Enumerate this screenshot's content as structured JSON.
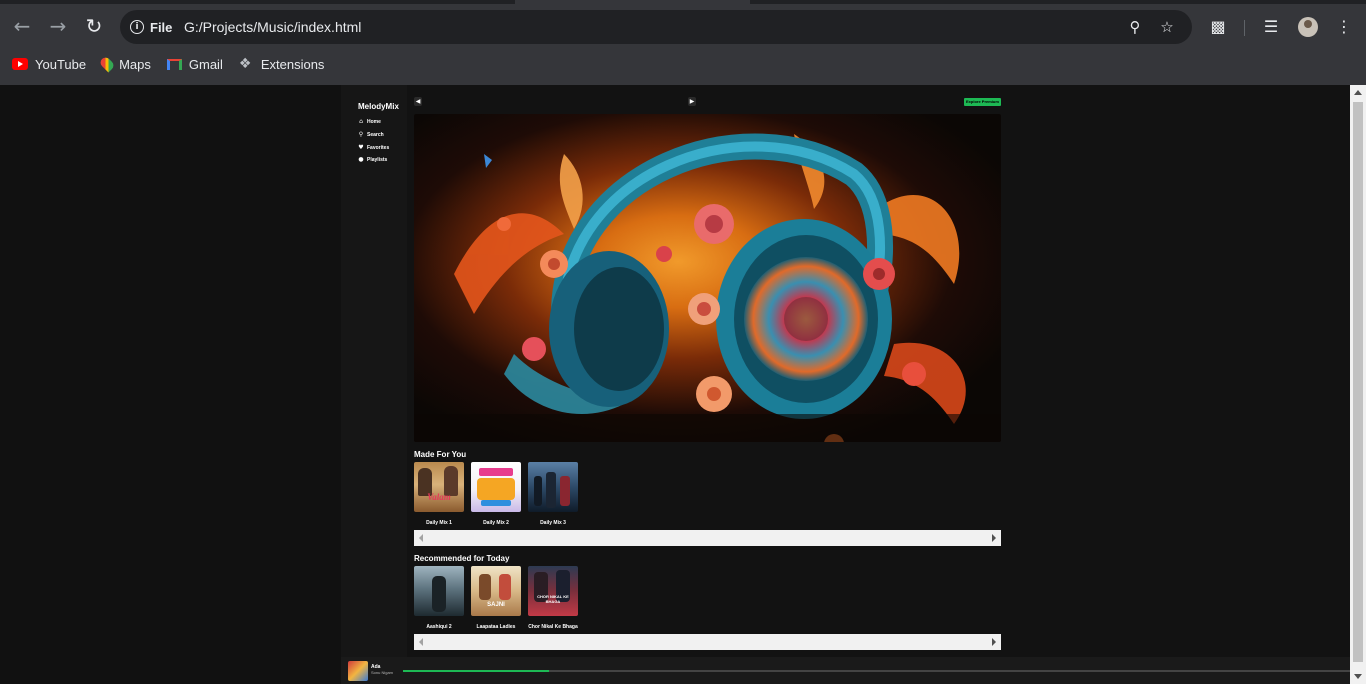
{
  "browser": {
    "url_chip": "File",
    "url": "G:/Projects/Music/index.html",
    "bookmarks": [
      {
        "label": "YouTube",
        "icon": "youtube-icon"
      },
      {
        "label": "Maps",
        "icon": "maps-icon"
      },
      {
        "label": "Gmail",
        "icon": "gmail-icon"
      },
      {
        "label": "Extensions",
        "icon": "puzzle-icon"
      }
    ]
  },
  "app": {
    "brand": "MelodyMix",
    "nav": [
      {
        "label": "Home",
        "icon": "home-icon"
      },
      {
        "label": "Search",
        "icon": "search-icon"
      },
      {
        "label": "Favorites",
        "icon": "heart-icon"
      },
      {
        "label": "Playlists",
        "icon": "playlist-icon"
      }
    ],
    "premium_label": "Explore Premium",
    "accent": "#1db954"
  },
  "sections": [
    {
      "title": "Made For You",
      "items": [
        {
          "label": "Daily Mix 1",
          "art_text": "Valam"
        },
        {
          "label": "Daily Mix 2",
          "art_text": ""
        },
        {
          "label": "Daily Mix 3",
          "art_text": ""
        }
      ]
    },
    {
      "title": "Recommended for Today",
      "items": [
        {
          "label": "Aashiqui 2",
          "art_text": ""
        },
        {
          "label": "Laapataa Ladies",
          "art_text": "SAJNI"
        },
        {
          "label": "Chor Nikal Ke Bhaga",
          "art_text": "CHOR NIKAL KE BHAGA"
        }
      ]
    }
  ],
  "player": {
    "title": "Ada",
    "artist": "Sonu Nigam",
    "progress": 0.154
  }
}
